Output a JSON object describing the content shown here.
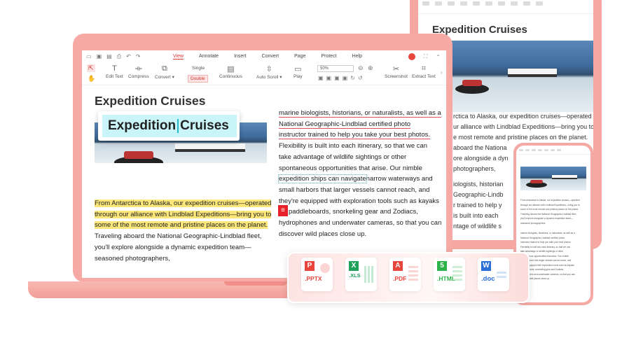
{
  "document": {
    "title": "Expedition Cruises",
    "overlay_title_part1": "Expedition",
    "overlay_title_part2": "Cruises",
    "left_column": [
      "From Antarctica to Alaska, our expedition cruises—operated",
      "through our alliance with Lindblad Expeditions—bring you to",
      "some of the most remote and pristine places on the planet.",
      "Traveling aboard the National Geographic-Lindblad fleet,",
      "you'll explore alongside a dynamic expedition team—",
      "seasoned photographers,"
    ],
    "right_column": [
      "marine biologists, historians, or naturalists, as well as a",
      "National Geographic-Lindblad certified photo",
      "instructor trained to help you take your best photos.",
      "Flexibility is built into each itinerary, so that we can",
      "take advantage of wildlife sightings or other",
      "spontaneous opportunities that arise. Our nimble",
      "expedition ships can navigate",
      "narrow waterways and",
      "small harbors that larger vessels cannot reach, and",
      "they're equipped with exploration tools such as kayaks",
      "paddleboards, snorkeling gear and Zodiacs,",
      "hydrophones and underwater cameras, so that you can",
      "discover wild places close up."
    ],
    "tablet_column": [
      "rctica to Alaska, our expedition cruises—operated",
      "ur alliance with Lindblad Expeditions—bring you to",
      "e most remote and pristine places on the planet.",
      "aboard the Nationa",
      "ore alongside a dyn",
      "photographers,",
      "",
      "iologists, historian",
      "Geographic-Lindb",
      "r trained to help y",
      "is built into each",
      "ntage of wildlife s"
    ]
  },
  "menu": {
    "tabs": [
      "View",
      "Annotate",
      "Insert",
      "Convert",
      "Page",
      "Protect",
      "Help"
    ],
    "active_tab": "View"
  },
  "toolbar": {
    "edit_text": "Edit Text",
    "compress": "Compress",
    "convert": "Convert ▾",
    "single": "Single",
    "double": "Double",
    "continuous": "Continuous",
    "auto_scroll": "Auto Scroll ▾",
    "play": "Play",
    "zoom": "50%",
    "screenshot": "Screenshot",
    "extract_text": "Extract Text"
  },
  "formats": [
    {
      "icon": "P",
      "label": ".PPTX",
      "color": "#e8453c"
    },
    {
      "icon": "X",
      "label": ".XLS",
      "color": "#21a05a"
    },
    {
      "icon": "A",
      "label": ".PDF",
      "color": "#e8453c"
    },
    {
      "icon": "5",
      "label": ".HTML",
      "color": "#2db34a"
    },
    {
      "icon": "W",
      "label": ".doc",
      "color": "#2a6fd6"
    }
  ]
}
